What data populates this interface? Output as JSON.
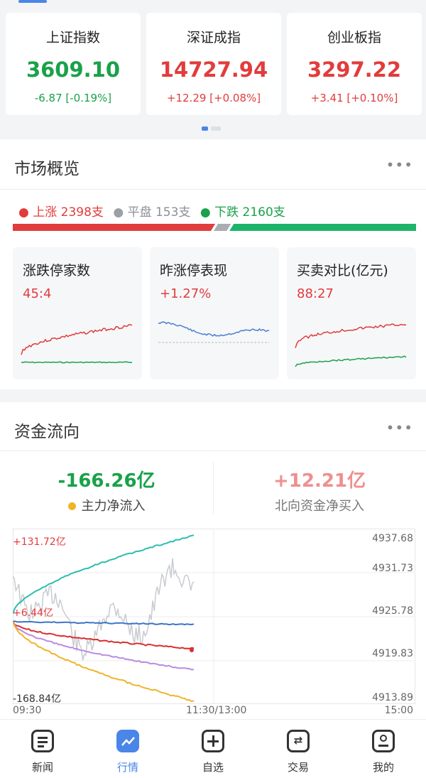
{
  "indices": [
    {
      "name": "上证指数",
      "price": "3609.10",
      "change": "-6.87 [-0.19%]",
      "color": "#1aa14a"
    },
    {
      "name": "深证成指",
      "price": "14727.94",
      "change": "+12.29 [+0.08%]",
      "color": "#e23c3c"
    },
    {
      "name": "创业板指",
      "price": "3297.22",
      "change": "+3.41 [+0.10%]",
      "color": "#e23c3c"
    }
  ],
  "market": {
    "title": "市场概览",
    "more": "•••",
    "rise_label": "上涨 2398支",
    "flat_label": "平盘 153支",
    "fall_label": "下跌 2160支",
    "rise_count": 2398,
    "flat_count": 153,
    "fall_count": 2160,
    "cards": [
      {
        "title": "涨跌停家数",
        "value": "45:4"
      },
      {
        "title": "昨涨停表现",
        "value": "+1.27%"
      },
      {
        "title": "买卖对比(亿元)",
        "value": "88:27"
      }
    ]
  },
  "fund_flow": {
    "title": "资金流向",
    "more": "•••",
    "main_value": "-166.26亿",
    "main_label": "主力净流入",
    "north_value": "+12.21亿",
    "north_label": "北向资金净买入",
    "chart": {
      "right_axis": [
        "4937.68",
        "4931.73",
        "4925.78",
        "4919.83",
        "4913.89"
      ],
      "annotations": [
        "+131.72亿",
        "+6.44亿",
        "-168.84亿"
      ],
      "x_labels": [
        "09:30",
        "11:30/13:00",
        "15:00"
      ]
    }
  },
  "colors": {
    "rise": "#e23c3c",
    "fall": "#1aa14a",
    "flat": "#9aa0a6",
    "accent": "#4a86e8"
  },
  "nav": [
    {
      "label": "新闻",
      "icon": "news-icon"
    },
    {
      "label": "行情",
      "icon": "market-trend-icon"
    },
    {
      "label": "自选",
      "icon": "add-watchlist-icon"
    },
    {
      "label": "交易",
      "icon": "trade-exchange-icon"
    },
    {
      "label": "我的",
      "icon": "profile-icon"
    }
  ]
}
